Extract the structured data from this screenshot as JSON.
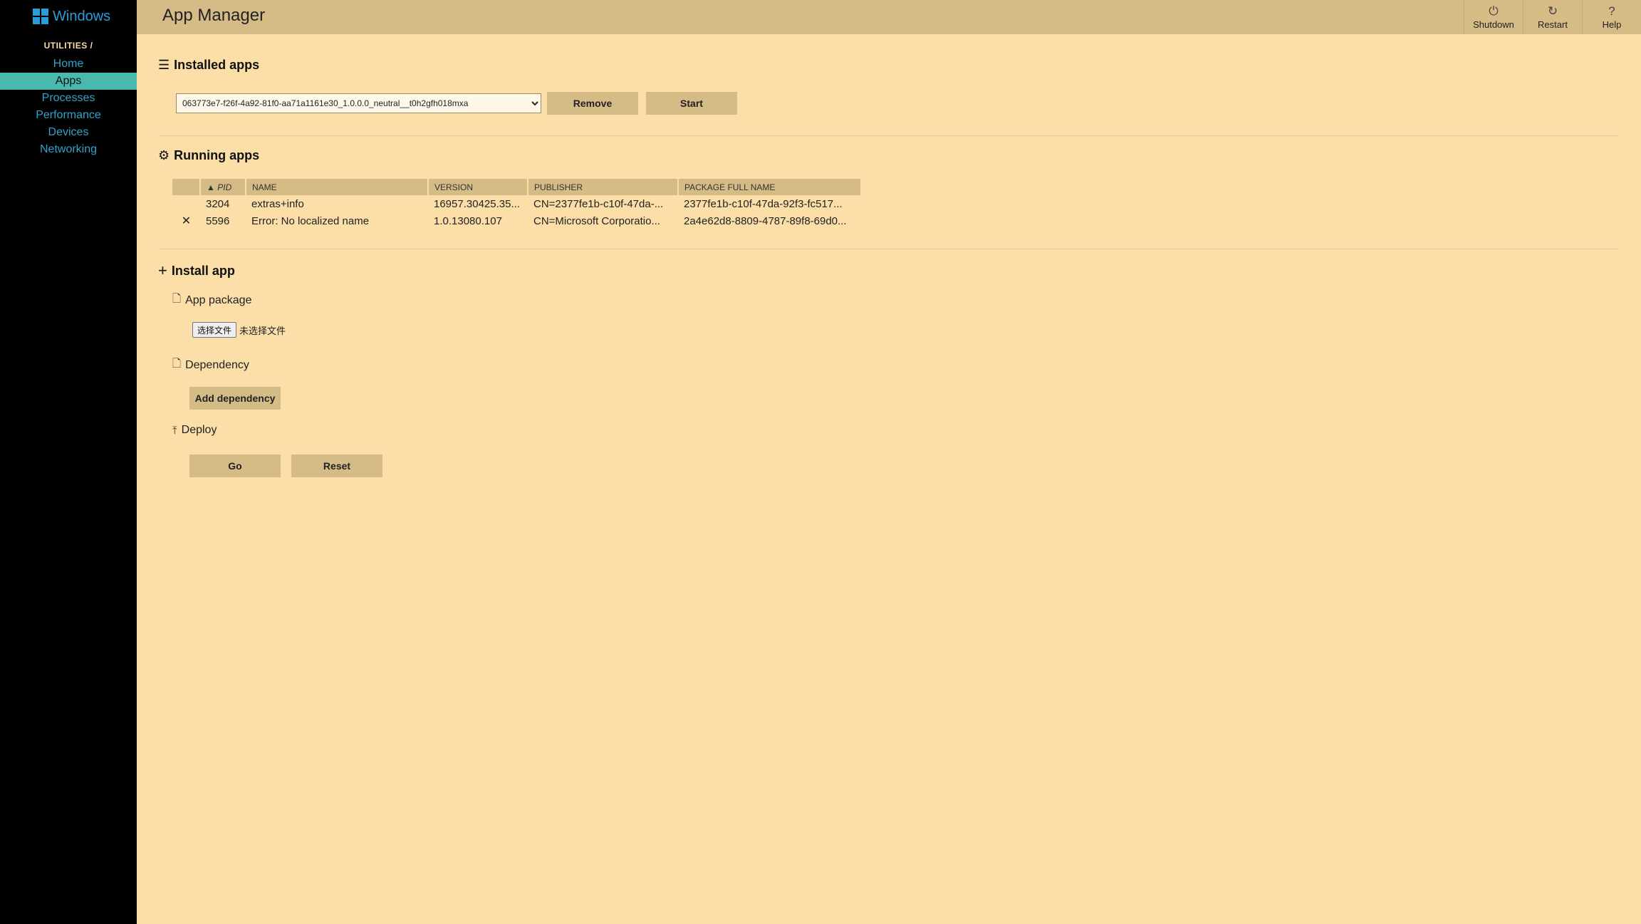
{
  "sidebar": {
    "logo_text": "Windows",
    "section_label": "UTILITIES /",
    "items": [
      {
        "label": "Home",
        "active": false
      },
      {
        "label": "Apps",
        "active": true
      },
      {
        "label": "Processes",
        "active": false
      },
      {
        "label": "Performance",
        "active": false
      },
      {
        "label": "Devices",
        "active": false
      },
      {
        "label": "Networking",
        "active": false
      }
    ]
  },
  "header": {
    "title": "App Manager",
    "buttons": [
      {
        "label": "Shutdown",
        "icon": "power-icon"
      },
      {
        "label": "Restart",
        "icon": "restart-icon"
      },
      {
        "label": "Help",
        "icon": "help-icon"
      }
    ]
  },
  "installed": {
    "title": "Installed apps",
    "selected_app": "063773e7-f26f-4a92-81f0-aa71a1161e30_1.0.0.0_neutral__t0h2gfh018mxa",
    "remove_label": "Remove",
    "start_label": "Start"
  },
  "running": {
    "title": "Running apps",
    "columns": [
      "PID",
      "NAME",
      "VERSION",
      "PUBLISHER",
      "PACKAGE FULL NAME"
    ],
    "sort_indicator": "▲",
    "rows": [
      {
        "close": "",
        "pid": "3204",
        "name": "extras+info",
        "version": "16957.30425.35...",
        "publisher": "CN=2377fe1b-c10f-47da-...",
        "package": "2377fe1b-c10f-47da-92f3-fc517..."
      },
      {
        "close": "✕",
        "pid": "5596",
        "name": "Error: No localized name",
        "version": "1.0.13080.107",
        "publisher": "CN=Microsoft Corporatio...",
        "package": "2a4e62d8-8809-4787-89f8-69d0..."
      }
    ]
  },
  "install": {
    "title": "Install app",
    "app_package_label": "App package",
    "choose_file_label": "选择文件",
    "no_file_label": "未选择文件",
    "dependency_label": "Dependency",
    "add_dependency_label": "Add dependency",
    "deploy_label": "Deploy",
    "go_label": "Go",
    "reset_label": "Reset"
  },
  "colors": {
    "background": "#fcdea8",
    "header": "#d5bb85",
    "sidebar": "#000000",
    "nav_link": "#2fa3c9",
    "nav_active": "#49b8ad"
  }
}
